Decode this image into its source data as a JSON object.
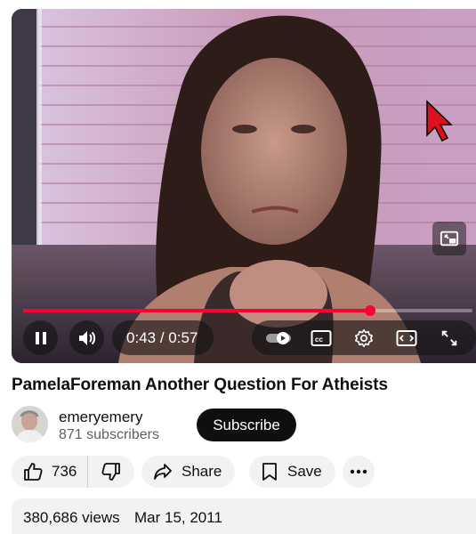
{
  "player": {
    "current_time": "0:43",
    "duration": "0:57",
    "progress": 0.772,
    "time_separator": "/",
    "state": "playing"
  },
  "video": {
    "title": "PamelaForeman Another Question For Atheists"
  },
  "channel": {
    "name": "emeryemery",
    "subscribers": "871 subscribers",
    "subscribe_label": "Subscribe"
  },
  "actions": {
    "likes": "736",
    "share_label": "Share",
    "save_label": "Save"
  },
  "description": {
    "views": "380,686 views",
    "date": "Mar 15, 2011"
  },
  "colors": {
    "progress": "#ff0033",
    "subscribe_bg": "#0f0f0f",
    "chip_bg": "#f2f2f2"
  },
  "icons": [
    "pause-icon",
    "volume-icon",
    "autoplay-toggle-icon",
    "captions-icon",
    "settings-gear-icon",
    "miniplayer-icon",
    "fullscreen-icon",
    "thumbs-up-icon",
    "thumbs-down-icon",
    "share-arrow-icon",
    "bookmark-icon",
    "more-dots-icon"
  ]
}
